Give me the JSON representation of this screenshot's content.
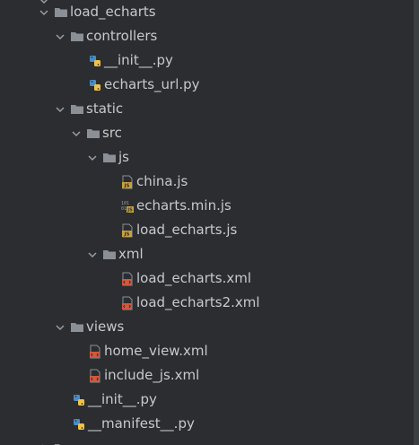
{
  "tree": {
    "top_partial": "",
    "rows": [
      {
        "label": "load_echarts",
        "type": "folder",
        "expanded": true
      },
      {
        "label": "controllers",
        "type": "folder",
        "expanded": true
      },
      {
        "label": "__init__.py",
        "type": "python"
      },
      {
        "label": "echarts_url.py",
        "type": "python"
      },
      {
        "label": "static",
        "type": "folder",
        "expanded": true
      },
      {
        "label": "src",
        "type": "folder",
        "expanded": true
      },
      {
        "label": "js",
        "type": "folder",
        "expanded": true
      },
      {
        "label": "china.js",
        "type": "js"
      },
      {
        "label": "echarts.min.js",
        "type": "minjs"
      },
      {
        "label": "load_echarts.js",
        "type": "js"
      },
      {
        "label": "xml",
        "type": "folder",
        "expanded": true
      },
      {
        "label": "load_echarts.xml",
        "type": "xml"
      },
      {
        "label": "load_echarts2.xml",
        "type": "xml"
      },
      {
        "label": "views",
        "type": "folder",
        "expanded": true
      },
      {
        "label": "home_view.xml",
        "type": "xml"
      },
      {
        "label": "include_js.xml",
        "type": "xml"
      },
      {
        "label": "__init__.py",
        "type": "python"
      },
      {
        "label": "__manifest__.py",
        "type": "python"
      }
    ]
  },
  "colors": {
    "background": "#2b2d30",
    "text": "#c7c9cc",
    "folder": "#8b8f96",
    "chevron": "#9a9da3",
    "python_blue": "#4a8cc7",
    "python_yellow": "#f0c24a",
    "js_yellow": "#c9a23a",
    "xml_red": "#d0593f"
  },
  "icons": {
    "folder": "folder-icon",
    "python": "python-file-icon",
    "js": "javascript-file-icon",
    "minjs": "minified-js-file-icon",
    "xml": "xml-file-icon",
    "chevron": "chevron-down-icon"
  }
}
